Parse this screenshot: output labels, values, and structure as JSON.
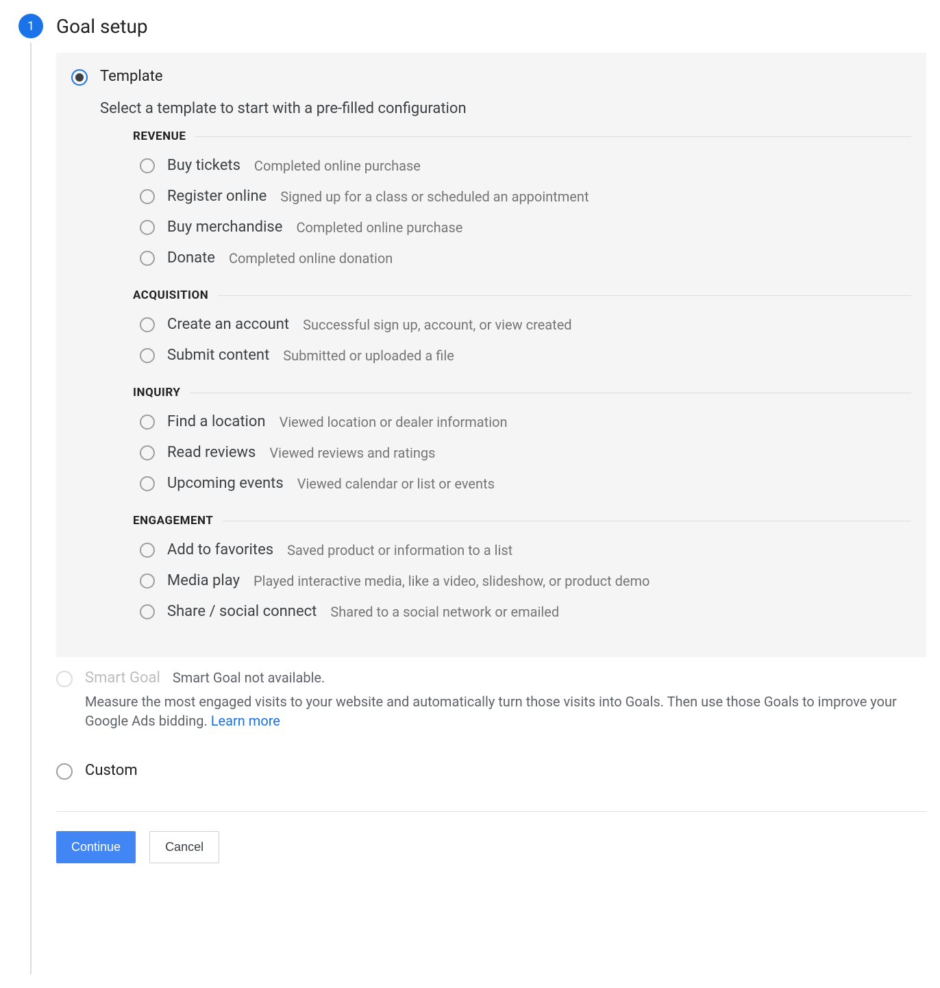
{
  "step_number": "1",
  "step_title": "Goal setup",
  "options": {
    "template": {
      "label": "Template",
      "subtitle": "Select a template to start with a pre-filled configuration"
    },
    "smart_goal": {
      "label": "Smart Goal",
      "inline_note": "Smart Goal not available.",
      "description": "Measure the most engaged visits to your website and automatically turn those visits into Goals. Then use those Goals to improve your Google Ads bidding. ",
      "learn_more": "Learn more"
    },
    "custom": {
      "label": "Custom"
    }
  },
  "groups": [
    {
      "title": "REVENUE",
      "items": [
        {
          "label": "Buy tickets",
          "desc": "Completed online purchase"
        },
        {
          "label": "Register online",
          "desc": "Signed up for a class or scheduled an appointment"
        },
        {
          "label": "Buy merchandise",
          "desc": "Completed online purchase"
        },
        {
          "label": "Donate",
          "desc": "Completed online donation"
        }
      ]
    },
    {
      "title": "ACQUISITION",
      "items": [
        {
          "label": "Create an account",
          "desc": "Successful sign up, account, or view created"
        },
        {
          "label": "Submit content",
          "desc": "Submitted or uploaded a file"
        }
      ]
    },
    {
      "title": "INQUIRY",
      "items": [
        {
          "label": "Find a location",
          "desc": "Viewed location or dealer information"
        },
        {
          "label": "Read reviews",
          "desc": "Viewed reviews and ratings"
        },
        {
          "label": "Upcoming events",
          "desc": "Viewed calendar or list or events"
        }
      ]
    },
    {
      "title": "ENGAGEMENT",
      "items": [
        {
          "label": "Add to favorites",
          "desc": "Saved product or information to a list"
        },
        {
          "label": "Media play",
          "desc": "Played interactive media, like a video, slideshow, or product demo"
        },
        {
          "label": "Share / social connect",
          "desc": "Shared to a social network or emailed"
        }
      ]
    }
  ],
  "buttons": {
    "continue": "Continue",
    "cancel": "Cancel"
  }
}
